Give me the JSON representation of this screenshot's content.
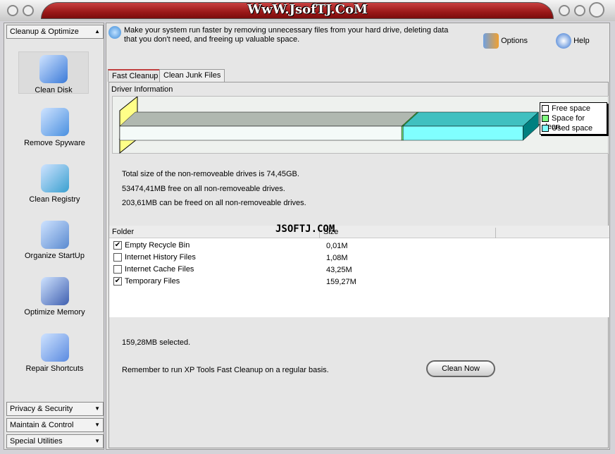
{
  "title": "WwW.JsofTJ.CoM",
  "watermark": "JSOFTJ.COM",
  "sidebar": {
    "top_category": "Cleanup & Optimize",
    "items": [
      {
        "label": "Clean Disk",
        "icon": "clean-disk-icon"
      },
      {
        "label": "Remove Spyware",
        "icon": "spyware-icon"
      },
      {
        "label": "Clean Registry",
        "icon": "registry-icon"
      },
      {
        "label": "Organize StartUp",
        "icon": "startup-icon"
      },
      {
        "label": "Optimize Memory",
        "icon": "memory-icon"
      },
      {
        "label": "Repair Shortcuts",
        "icon": "shortcuts-icon"
      }
    ],
    "bottom_categories": [
      "Privacy & Security",
      "Maintain & Control",
      "Special Utilities"
    ]
  },
  "header": {
    "description": "Make your system run faster by removing unnecessary files from your hard drive, deleting data that you don't need, and freeing up valuable space.",
    "options": "Options",
    "help": "Help"
  },
  "tabs": [
    "Fast Cleanup",
    "Clean Junk Files"
  ],
  "group_title": "Driver Information",
  "info": [
    "Total size of the non-removeable drives is 74,45GB.",
    "53474,41MB free on all non-removeable drives.",
    "203,61MB can be freed on all non-removeable drives."
  ],
  "columns": [
    "Folder",
    "Size"
  ],
  "rows": [
    {
      "name": "Empty Recycle Bin",
      "size": "0,01M",
      "checked": true
    },
    {
      "name": "Internet History Files",
      "size": "1,08M",
      "checked": false
    },
    {
      "name": "Internet Cache Files",
      "size": "43,25M",
      "checked": false
    },
    {
      "name": "Temporary Files",
      "size": "159,27M",
      "checked": true
    }
  ],
  "selected": "159,28MB selected.",
  "reminder": "Remember to run XP Tools Fast Cleanup on a regular basis.",
  "clean_button": "Clean Now",
  "chart_data": {
    "type": "bar",
    "stacked": true,
    "orientation": "horizontal",
    "unit": "MB",
    "series": [
      {
        "name": "Free space",
        "values": [
          53474.41
        ],
        "color": "#ffffff"
      },
      {
        "name": "Space for clean",
        "values": [
          203.61
        ],
        "color": "#80ff80"
      },
      {
        "name": "Used space",
        "values": [
          22763
        ],
        "color": "#80ffff"
      }
    ],
    "legend": "right"
  }
}
